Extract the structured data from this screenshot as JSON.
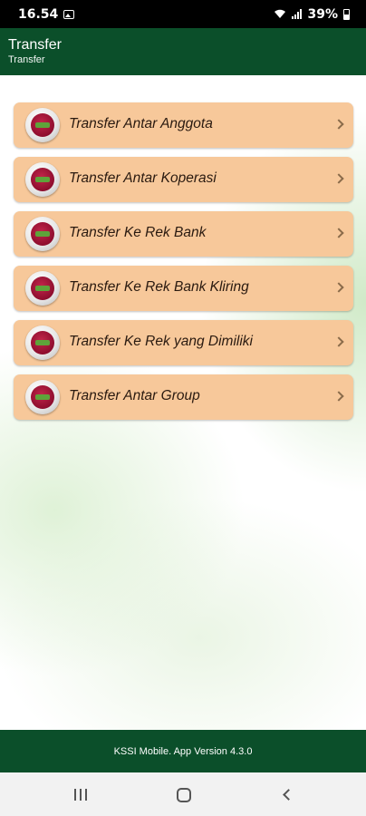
{
  "status_bar": {
    "time": "16.54",
    "battery": "39%",
    "icons": [
      "gallery-icon",
      "wifi-icon",
      "signal-icon",
      "battery-icon"
    ]
  },
  "app_bar": {
    "title": "Transfer",
    "subtitle": "Transfer"
  },
  "menu": {
    "items": [
      {
        "label": "Transfer Antar Anggota"
      },
      {
        "label": "Transfer Antar Koperasi"
      },
      {
        "label": "Transfer Ke Rek Bank"
      },
      {
        "label": "Transfer Ke Rek Bank Kliring"
      },
      {
        "label": "Transfer Ke Rek yang Dimiliki"
      },
      {
        "label": "Transfer Antar Group"
      }
    ],
    "item_color": "#f7c89a"
  },
  "footer": {
    "text": "KSSI Mobile. App Version 4.3.0"
  },
  "colors": {
    "primary": "#0b4f2a",
    "accent": "#f7c89a"
  }
}
